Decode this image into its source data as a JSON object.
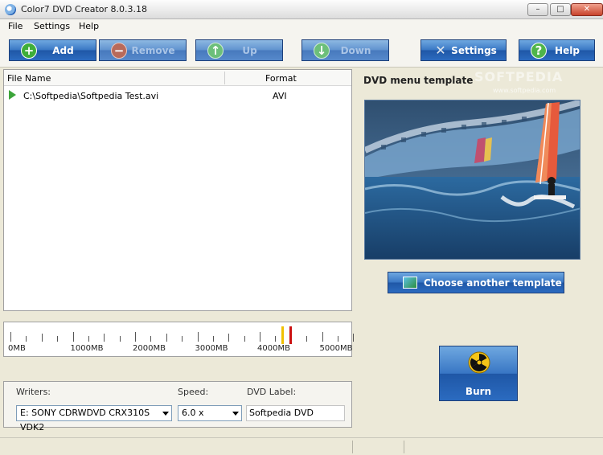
{
  "window": {
    "title": "Color7 DVD Creator 8.0.3.18",
    "controls": [
      "–",
      "□",
      "✕"
    ]
  },
  "menu": [
    "File",
    "Settings",
    "Help"
  ],
  "toolbar": {
    "add": "Add",
    "remove": "Remove",
    "up": "Up",
    "down": "Down",
    "settings": "Settings",
    "help": "Help"
  },
  "watermark": {
    "main": "SOFTPEDIA",
    "sub": "www.softpedia.com"
  },
  "file_list": {
    "col_name": "File Name",
    "col_format": "Format",
    "rows": [
      {
        "name": "C:\\Softpedia\\Softpedia Test.avi",
        "format": "AVI"
      }
    ]
  },
  "size_ruler": {
    "labels": [
      "0MB",
      "1000MB",
      "2000MB",
      "3000MB",
      "4000MB",
      "5000MB"
    ],
    "max_mb": 5500,
    "markers": [
      {
        "name": "dvd5-limit",
        "mb": 4350,
        "color": "#f0c000"
      },
      {
        "name": "dvd-capacity-limit",
        "mb": 4480,
        "color": "#cc1010"
      }
    ]
  },
  "writer": {
    "writers_label": "Writers:",
    "writer_value": "E: SONY CDRWDVD CRX310S VDK2",
    "speed_label": "Speed:",
    "speed_value": "6.0 x",
    "dvd_label_label": "DVD Label:",
    "dvd_label_value": "Softpedia DVD"
  },
  "template": {
    "title": "DVD menu template",
    "choose_label": "Choose another template"
  },
  "burn": {
    "label": "Burn"
  },
  "colors": {
    "button_blue": "#2b6bc0",
    "accent_green": "#3ca53a"
  }
}
